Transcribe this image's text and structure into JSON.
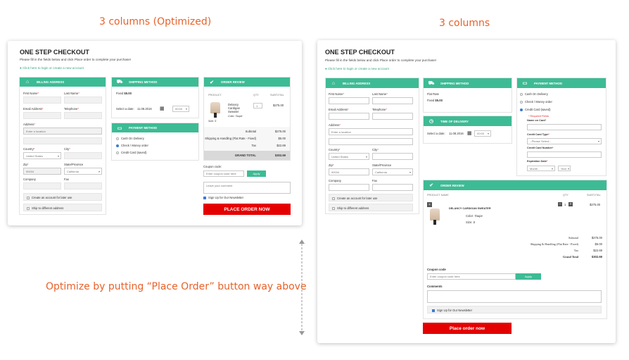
{
  "captions": {
    "left": "3 columns (Optimized)",
    "right": "3 columns",
    "note": "Optimize by putting “Place Order” button way above"
  },
  "left": {
    "title": "ONE STEP CHECKOUT",
    "subtitle": "Please fill in the fields below and click Place order to complete your purchase!",
    "login_link": "Click here to login or create a new account",
    "billing": {
      "header": "BILLING ADDRESS",
      "first_name": "First Name",
      "last_name": "Last Name",
      "email": "Email Address",
      "telephone": "Telephone",
      "address": "Address",
      "address_placeholder": "Enter a location",
      "country": "Country",
      "country_value": "United States",
      "city": "City",
      "zip": "Zip",
      "zip_value": "90034",
      "state": "State/Province",
      "state_value": "California",
      "company": "Company",
      "fax": "Fax",
      "create_account": "Create an account for later use",
      "ship_different": "Ship to different address"
    },
    "shipping": {
      "header": "SHIPPING METHOD",
      "fixed": "Fixed",
      "fixed_price": "$5.00",
      "select_date": "Select a date:",
      "date_value": "11.08.2016",
      "time_value": "00:00"
    },
    "payment": {
      "header": "PAYMENT METHOD",
      "options": [
        "Cash On Delivery",
        "Check / Money order",
        "Credit Card (saved)"
      ]
    },
    "order": {
      "header": "ORDER REVIEW",
      "col_product": "PRODUCT",
      "col_qty": "QTY",
      "col_subtotal": "SUBTOTAL",
      "product_name": "Delancy Cardigan Sweater",
      "color": "Color: Taupe",
      "size": "Size: S",
      "qty": "1",
      "price": "$275.00",
      "subtotal_label": "Subtotal",
      "subtotal": "$275.00",
      "shipping_label": "Shipping & Handling (Flat Rate - Fixed)",
      "shipping": "$5.00",
      "tax_label": "Tax",
      "tax": "$22.69",
      "grand_label": "GRAND TOTAL",
      "grand": "$302.69",
      "coupon_label": "Coupon code:",
      "coupon_placeholder": "Enter coupon code here",
      "apply": "Apply",
      "comment_placeholder": "Leave your comment",
      "newsletter": "Sign Up for Our Newsletter",
      "place_order": "PLACE ORDER NOW"
    }
  },
  "right": {
    "title": "ONE STEP CHECKOUT",
    "subtitle": "Please fill in the fields below and click Place order to complete your purchase!",
    "login_link": "Click here to login or create a new account",
    "billing": {
      "header": "BILLING ADDRESS",
      "first_name": "First Name",
      "last_name": "Last Name",
      "email": "Email Address",
      "telephone": "Telephone",
      "address": "Address",
      "address_placeholder": "Enter a location",
      "country": "Country",
      "country_value": "United States",
      "city": "City",
      "zip": "Zip",
      "zip_value": "90034",
      "state": "State/Province",
      "state_value": "California",
      "company": "Company",
      "fax": "Fax",
      "create_account": "Create an account for later use",
      "ship_different": "Ship to different address"
    },
    "shipping": {
      "header": "SHIPPING METHOD",
      "flat": "Flat Rate",
      "fixed": "Fixed",
      "fixed_price": "$5.00"
    },
    "delivery": {
      "header": "TIME OF DELIVERY",
      "select_date": "Select a date:",
      "date_value": "11.08.2016",
      "time_value": "00:00"
    },
    "payment": {
      "header": "PAYMENT METHOD",
      "options": [
        "Cash On Delivery",
        "Check / Money order",
        "Credit Card (saved)"
      ],
      "required": "* Required Fields",
      "name_on_card": "Name on Card",
      "card_type": "Credit Card Type",
      "card_type_value": "--Please Select--",
      "card_number": "Credit Card Number",
      "expiration": "Expiration Date",
      "month": "Month",
      "year": "Year"
    },
    "order": {
      "header": "ORDER REVIEW",
      "col_product": "PRODUCT NAME",
      "col_qty": "QTY",
      "col_subtotal": "SUBTOTAL",
      "product_name": "DELANCY CARDIGAN SWEATER",
      "color_label": "Color:",
      "color": "Taupe",
      "size_label": "Size:",
      "size": "S",
      "qty": "1",
      "price": "$275.00",
      "subtotal_label": "Subtotal",
      "subtotal": "$275.00",
      "shipping_label": "Shipping & Handling (Flat Rate - Fixed)",
      "shipping": "$5.00",
      "tax_label": "Tax",
      "tax": "$22.69",
      "grand_label": "Grand Total",
      "grand": "$302.69",
      "coupon_label": "Coupon code",
      "coupon_placeholder": "Enter coupon code here",
      "apply": "Apply",
      "comments_label": "Comments",
      "newsletter": "Sign Up for Our Newsletter",
      "place_order": "Place order now"
    }
  }
}
